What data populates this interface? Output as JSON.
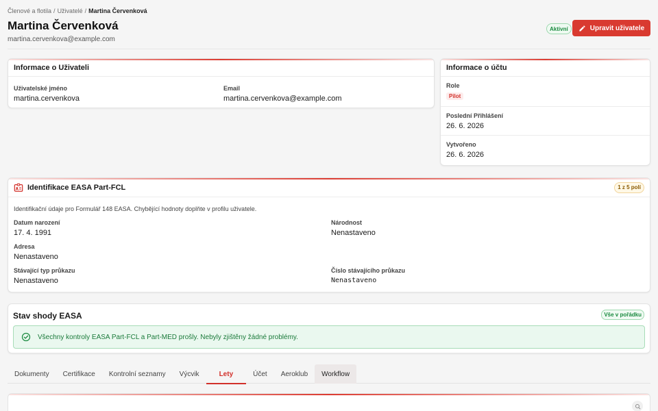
{
  "breadcrumb": {
    "items": [
      "Členové a flotila",
      "Uživatelé"
    ],
    "separator": "/",
    "current": "Martina Červenková"
  },
  "header": {
    "title": "Martina Červenková",
    "email": "martina.cervenkova@example.com",
    "status": "Aktivní",
    "edit_label": "Upravit uživatele"
  },
  "user_info": {
    "title": "Informace o Uživateli",
    "username_label": "Uživatelské jméno",
    "username": "martina.cervenkova",
    "email_label": "Email",
    "email": "martina.cervenkova@example.com"
  },
  "account": {
    "title": "Informace o účtu",
    "role_label": "Role",
    "role": "Pilot",
    "last_login_label": "Poslední Přihlášení",
    "last_login": "26. 6. 2026",
    "created_label": "Vytvořeno",
    "created": "26. 6. 2026"
  },
  "easa": {
    "title": "Identifikace EASA Part-FCL",
    "count": "1 z 5 polí",
    "description": "Identifikační údaje pro Formulář 148 EASA. Chybějící hodnoty doplňte v profilu uživatele.",
    "dob_label": "Datum narození",
    "dob": "17. 4. 1991",
    "nationality_label": "Národnost",
    "nationality": "Nenastaveno",
    "address_label": "Adresa",
    "address": "Nenastaveno",
    "license_type_label": "Stávající typ průkazu",
    "license_type": "Nenastaveno",
    "license_number_label": "Číslo stávajícího průkazu",
    "license_number": "Nenastaveno"
  },
  "compliance": {
    "title": "Stav shody EASA",
    "badge": "Vše v pořádku",
    "message": "Všechny kontroly EASA Part-FCL a Part-MED prošly. Nebyly zjištěny žádné problémy."
  },
  "tabs": {
    "items": [
      "Dokumenty",
      "Certifikace",
      "Kontrolní seznamy",
      "Výcvik",
      "Lety",
      "Účet",
      "Aeroklub",
      "Workflow"
    ],
    "active": "Lety",
    "hovered": "Workflow"
  },
  "colors": {
    "accent": "#d93a30",
    "success": "#1a8a3f",
    "warning": "#8a5a00"
  },
  "icons": {
    "edit": "pencil-icon",
    "id": "id-card-icon",
    "ok": "check-circle-icon",
    "search": "search-icon"
  }
}
